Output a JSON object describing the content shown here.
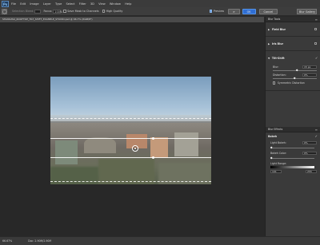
{
  "app": {
    "logo": "Ps"
  },
  "menu": [
    "File",
    "Edit",
    "Image",
    "Layer",
    "Type",
    "Select",
    "Filter",
    "3D",
    "View",
    "Window",
    "Help"
  ],
  "options": {
    "selection_bleed_label": "Selection Bleed:",
    "focus_label": "Focus:",
    "focus_value": "100%",
    "save_mask_label": "Save Mask to Channels",
    "high_quality_label": "High Quality",
    "preview_label": "Preview",
    "ok_label": "OK",
    "cancel_label": "Cancel",
    "workspace": "Blur Gallery"
  },
  "document": {
    "tab_title": "SHANGHAI_ROOFTOP_TILT_SHIFT_EXAMPLE_STUDIO.psd @ 66.7% (RGB/8*)"
  },
  "status": {
    "zoom": "66.67%",
    "doc_size": "Doc: 2.90M/2.90M"
  },
  "panel": {
    "blur_tools_header": "Blur Tools",
    "blur_effects_header": "Blur Effects",
    "field_blur": "Field Blur",
    "iris_blur": "Iris Blur",
    "tilt_shift": "Tilt-Shift",
    "blur_label": "Blur:",
    "blur_value": "15 px",
    "distortion_label": "Distortion:",
    "distortion_value": "0%",
    "symmetric_label": "Symmetric Distortion",
    "bokeh_label": "Bokeh",
    "light_bokeh_label": "Light Bokeh:",
    "light_bokeh_value": "0%",
    "bokeh_color_label": "Bokeh Color:",
    "bokeh_color_value": "0%",
    "light_range_label": "Light Range:",
    "light_range_low": "191",
    "light_range_high": "255",
    "blur_level": 0.55,
    "distortion_level": 0.5,
    "light_bokeh_level": 0.0,
    "bokeh_color_level": 0.0
  },
  "colors": {
    "accent": "#2f6ed4",
    "background": "#282828",
    "panel": "#3a3a3a"
  }
}
